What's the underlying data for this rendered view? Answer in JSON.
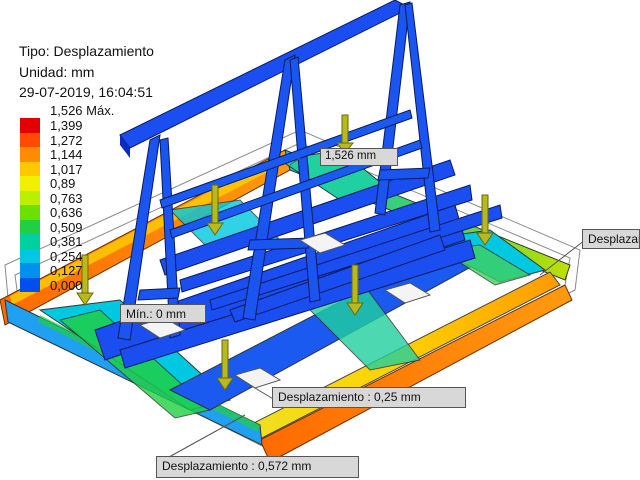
{
  "header": {
    "type_line": "Tipo: Desplazamiento",
    "unit_line": "Unidad: mm",
    "date_line": "29-07-2019, 16:04:51"
  },
  "legend": {
    "max_label": "1,526 Máx.",
    "ticks": [
      "1,399",
      "1,272",
      "1,144",
      "1,017",
      "0,89",
      "0,763",
      "0,636",
      "0,509",
      "0,381",
      "0,254",
      "0,127",
      "0,000"
    ],
    "colors": [
      "#e30000",
      "#ff4a00",
      "#ff8c00",
      "#ffc800",
      "#f0f000",
      "#b8f000",
      "#6ce000",
      "#20d040",
      "#00d0a0",
      "#00c8e0",
      "#0090f0",
      "#0050f0"
    ]
  },
  "probes": {
    "max": "1,526 mm",
    "min": "Mín.: 0 mm",
    "right": "Desplazamiento",
    "middle": "Desplazamiento : 0,25 mm",
    "bottom": "Desplazamiento : 0,572 mm"
  }
}
